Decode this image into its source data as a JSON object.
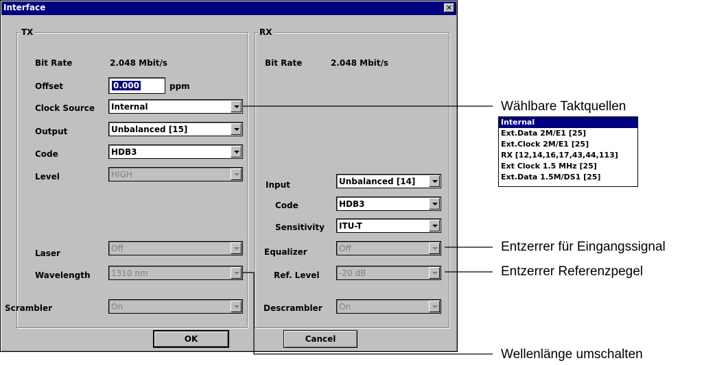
{
  "dialog": {
    "title": "Interface",
    "close_label": "✕"
  },
  "tx": {
    "group_label": "TX",
    "bit_rate_label": "Bit Rate",
    "bit_rate_value": "2.048 Mbit/s",
    "offset_label": "Offset",
    "offset_value": "0.000",
    "offset_unit": "ppm",
    "clock_source_label": "Clock Source",
    "clock_source_value": "Internal",
    "output_label": "Output",
    "output_value": "Unbalanced [15]",
    "code_label": "Code",
    "code_value": "HDB3",
    "level_label": "Level",
    "level_value": "HIGH",
    "laser_label": "Laser",
    "laser_value": "Off",
    "wavelength_label": "Wavelength",
    "wavelength_value": "1310 nm",
    "scrambler_label": "Scrambler",
    "scrambler_value": "On"
  },
  "rx": {
    "group_label": "RX",
    "bit_rate_label": "Bit Rate",
    "bit_rate_value": "2.048 Mbit/s",
    "input_label": "Input",
    "input_value": "Unbalanced [14]",
    "code_label": "Code",
    "code_value": "HDB3",
    "sensitivity_label": "Sensitivity",
    "sensitivity_value": "ITU-T",
    "equalizer_label": "Equalizer",
    "equalizer_value": "Off",
    "ref_level_label": "Ref. Level",
    "ref_level_value": "-20 dB",
    "descrambler_label": "Descrambler",
    "descrambler_value": "On"
  },
  "buttons": {
    "ok": "OK",
    "cancel": "Cancel"
  },
  "annotations": {
    "clock_sources": "Wählbare Taktquellen",
    "equalizer": "Entzerrer für Eingangssignal",
    "ref_level": "Entzerrer Referenzpegel",
    "wavelength": "Wellenlänge umschalten"
  },
  "clock_source_options": [
    "Internal",
    "Ext.Data 2M/E1 [25]",
    "Ext.Clock 2M/E1 [25]",
    "RX [12,14,16,17,43,44,113]",
    "Ext Clock 1.5 MHz [25]",
    "Ext.Data 1.5M/DS1 [25]"
  ]
}
